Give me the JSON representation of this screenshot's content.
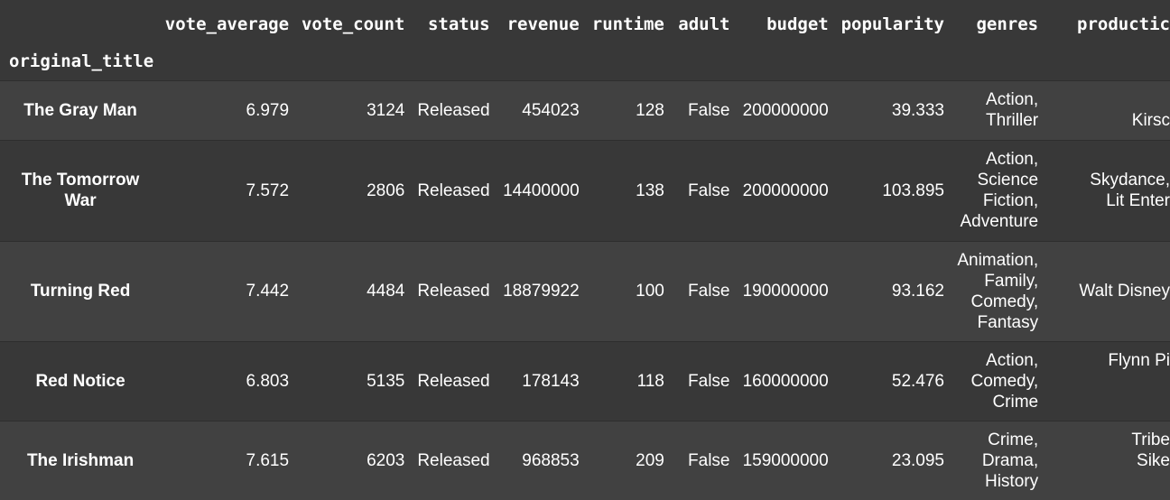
{
  "table": {
    "index_name": "original_title",
    "columns": [
      "vote_average",
      "vote_count",
      "status",
      "revenue",
      "runtime",
      "adult",
      "budget",
      "popularity",
      "genres",
      "productic"
    ],
    "rows": [
      {
        "title": "The Gray Man",
        "vote_average": "6.979",
        "vote_count": "3124",
        "status": "Released",
        "revenue": "454023",
        "runtime": "128",
        "adult": "False",
        "budget": "200000000",
        "popularity": "39.333",
        "genres": [
          "Action,",
          "Thriller"
        ],
        "production": [
          "",
          "Kirsc"
        ]
      },
      {
        "title": "The Tomorrow War",
        "vote_average": "7.572",
        "vote_count": "2806",
        "status": "Released",
        "revenue": "14400000",
        "runtime": "138",
        "adult": "False",
        "budget": "200000000",
        "popularity": "103.895",
        "genres": [
          "Action,",
          "Science",
          "Fiction,",
          "Adventure"
        ],
        "production": [
          "Skydance,",
          "Lit Enter"
        ]
      },
      {
        "title": "Turning Red",
        "vote_average": "7.442",
        "vote_count": "4484",
        "status": "Released",
        "revenue": "18879922",
        "runtime": "100",
        "adult": "False",
        "budget": "190000000",
        "popularity": "93.162",
        "genres": [
          "Animation,",
          "Family,",
          "Comedy,",
          "Fantasy"
        ],
        "production": [
          "Walt Disney"
        ]
      },
      {
        "title": "Red Notice",
        "vote_average": "6.803",
        "vote_count": "5135",
        "status": "Released",
        "revenue": "178143",
        "runtime": "118",
        "adult": "False",
        "budget": "160000000",
        "popularity": "52.476",
        "genres": [
          "Action,",
          "Comedy,",
          "Crime"
        ],
        "production": [
          "Flynn Pi",
          "",
          ""
        ]
      },
      {
        "title": "The Irishman",
        "vote_average": "7.615",
        "vote_count": "6203",
        "status": "Released",
        "revenue": "968853",
        "runtime": "209",
        "adult": "False",
        "budget": "159000000",
        "popularity": "23.095",
        "genres": [
          "Crime,",
          "Drama,",
          "History"
        ],
        "production": [
          "Tribe",
          "Sike",
          ""
        ]
      }
    ]
  }
}
